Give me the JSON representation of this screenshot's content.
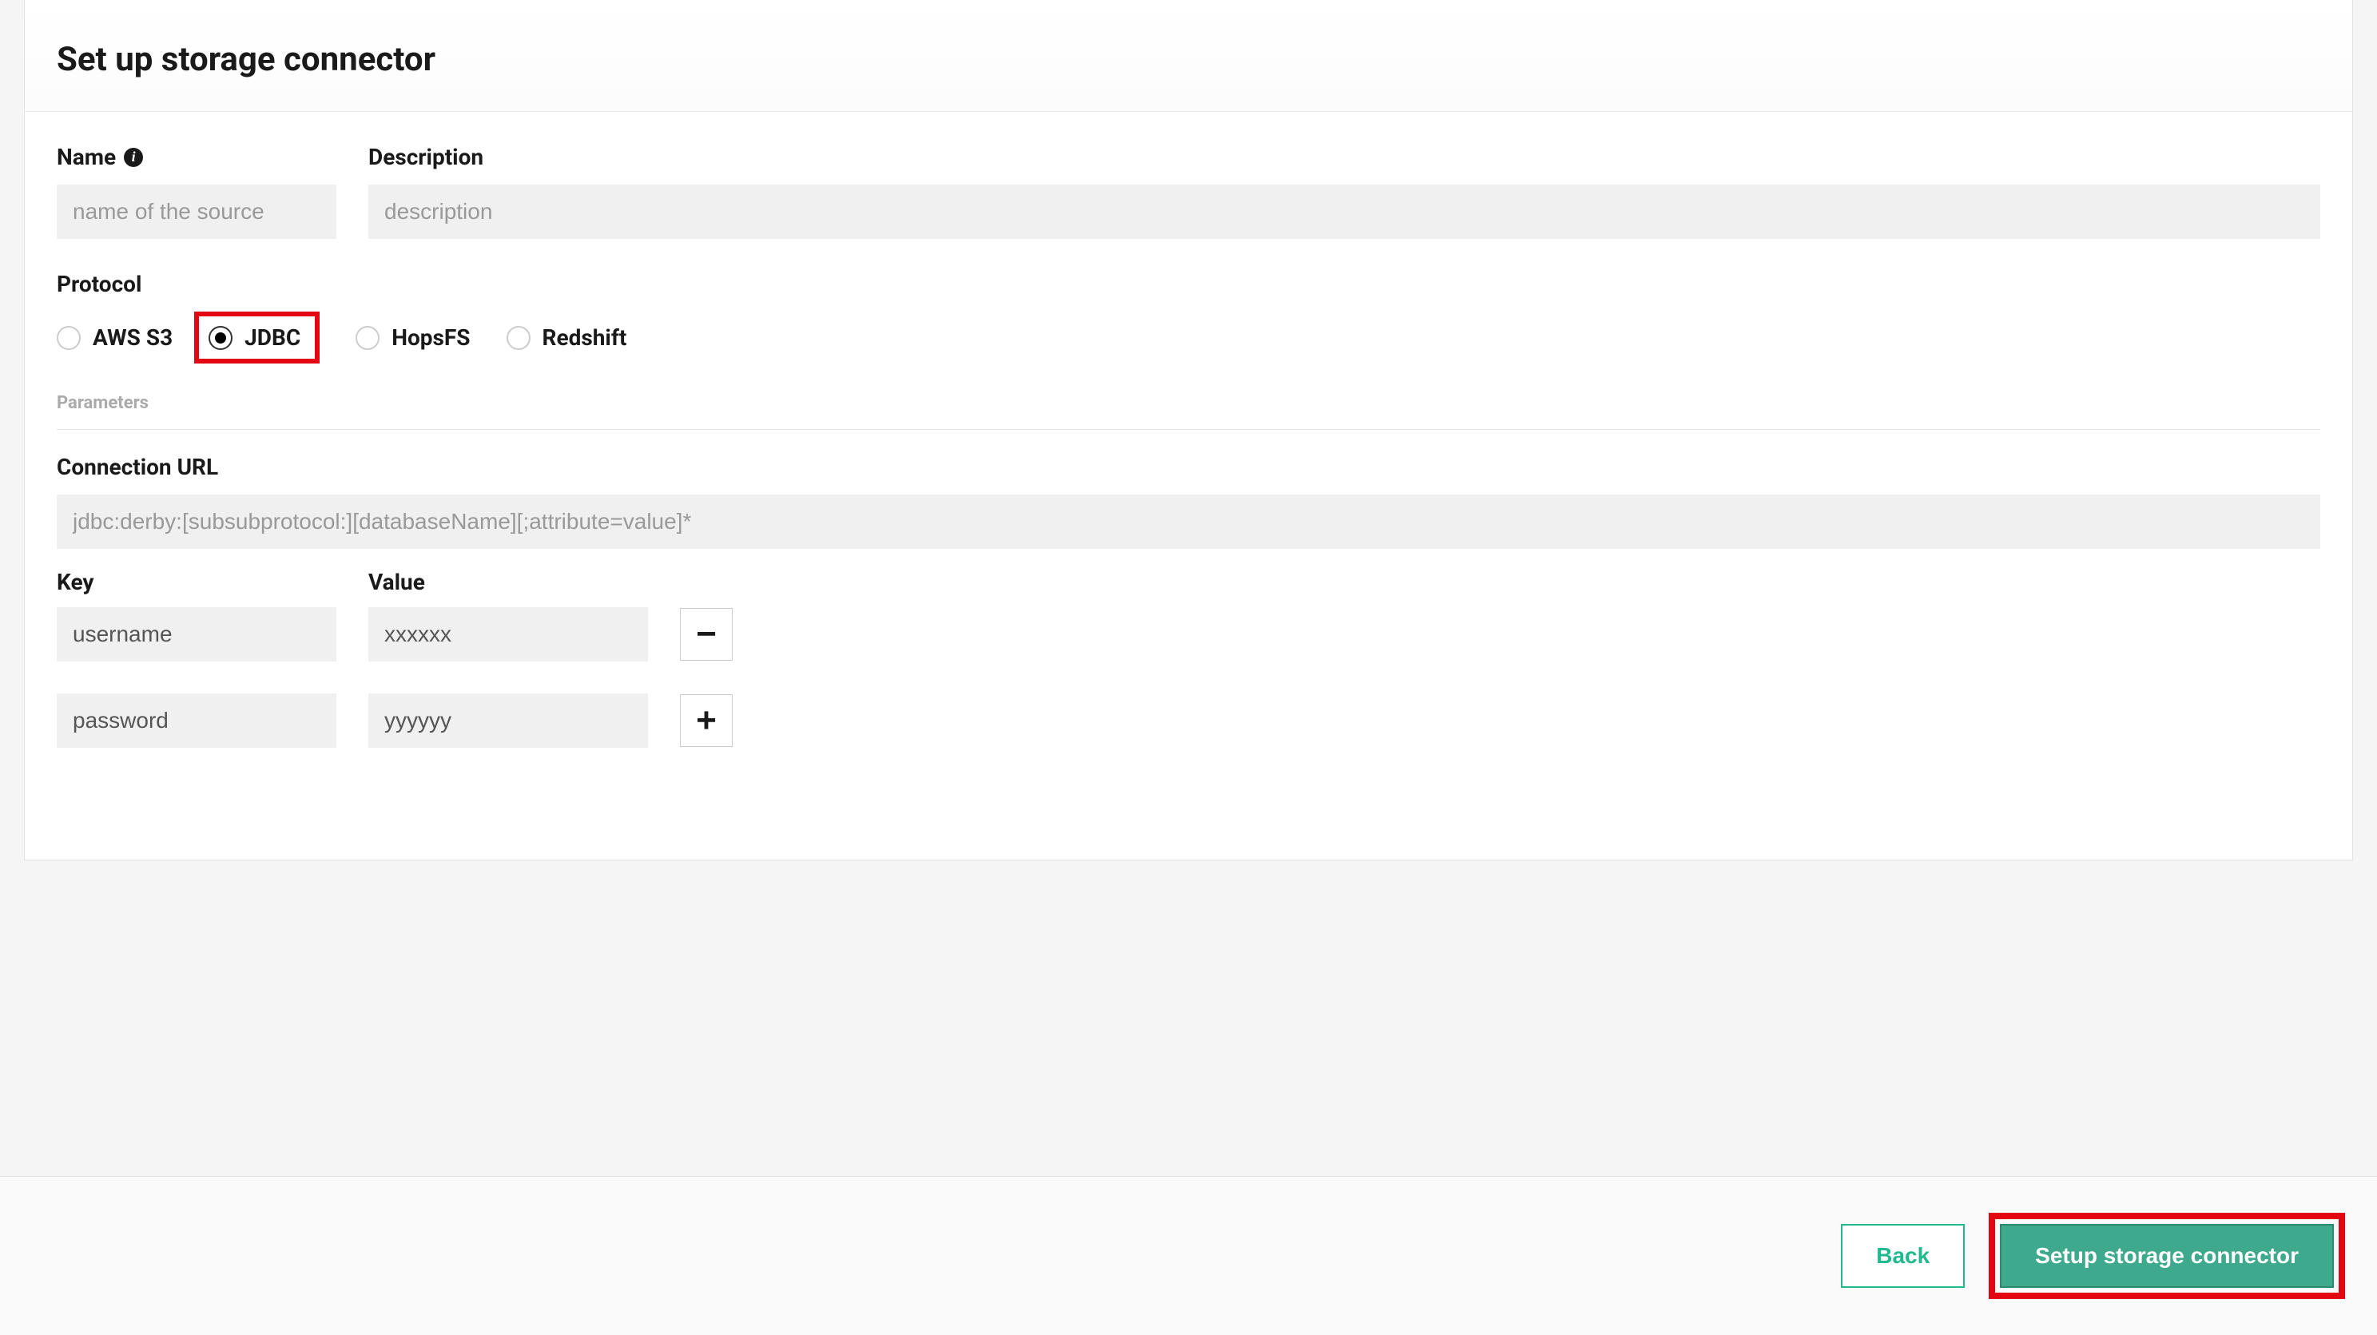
{
  "header": {
    "title": "Set up storage connector"
  },
  "form": {
    "name_label": "Name",
    "name_placeholder": "name of the source",
    "name_value": "",
    "description_label": "Description",
    "description_placeholder": "description",
    "description_value": ""
  },
  "protocol": {
    "label": "Protocol",
    "options": [
      {
        "label": "AWS S3",
        "selected": false
      },
      {
        "label": "JDBC",
        "selected": true
      },
      {
        "label": "HopsFS",
        "selected": false
      },
      {
        "label": "Redshift",
        "selected": false
      }
    ]
  },
  "parameters": {
    "section_label": "Parameters",
    "connection_url_label": "Connection URL",
    "connection_url_placeholder": "jdbc:derby:[subsubprotocol:][databaseName][;attribute=value]*",
    "connection_url_value": "",
    "key_header": "Key",
    "value_header": "Value",
    "rows": [
      {
        "key": "username",
        "value": "xxxxxx",
        "action": "remove"
      },
      {
        "key": "password",
        "value": "yyyyyy",
        "action": "add"
      }
    ]
  },
  "footer": {
    "back_label": "Back",
    "submit_label": "Setup storage connector"
  },
  "icons": {
    "minus": "−",
    "plus": "+"
  }
}
